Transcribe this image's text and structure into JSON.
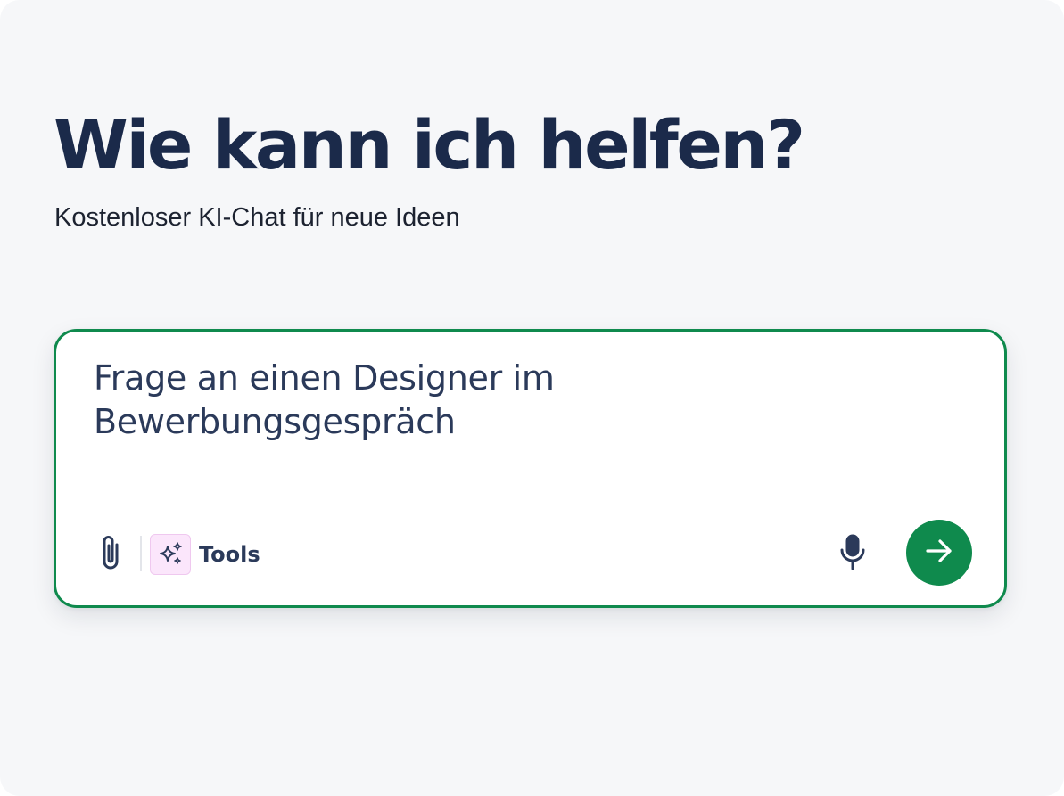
{
  "header": {
    "title": "Wie kann ich helfen?",
    "subtitle": "Kostenloser KI-Chat für neue Ideen"
  },
  "chat": {
    "input_value": "Frage an einen Designer im Bewerbungsgespräch",
    "tools_label": "Tools",
    "icons": {
      "attach": "paperclip-icon",
      "tools": "sparkles-icon",
      "mic": "microphone-icon",
      "send": "arrow-right-icon"
    }
  },
  "colors": {
    "accent": "#0f8a4d",
    "title_text": "#1b2a4a",
    "input_text": "#2b3a5a",
    "page_background": "#f6f7f9",
    "tools_badge_background": "#fbe6fb"
  }
}
